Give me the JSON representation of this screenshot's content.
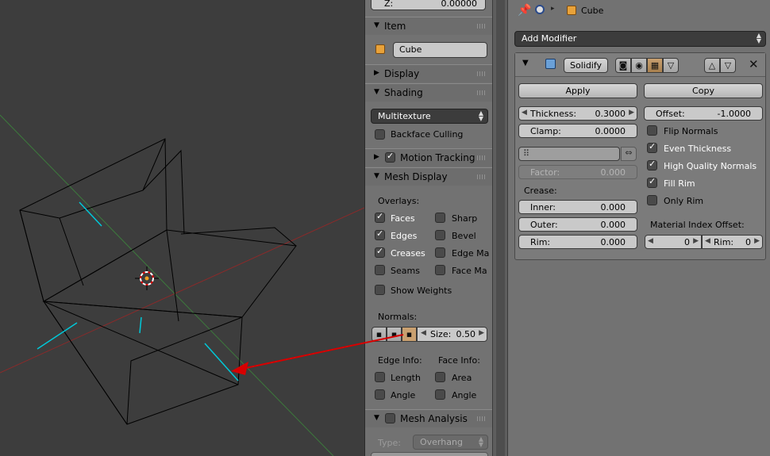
{
  "npanel": {
    "z_label": "Z:",
    "z_value": "0.00000",
    "item_header": "Item",
    "item_name": "Cube",
    "display_header": "Display",
    "shading_header": "Shading",
    "shading_mode": "Multitexture",
    "backface_culling": "Backface Culling",
    "motion_tracking_header": "Motion Tracking",
    "mesh_display_header": "Mesh Display",
    "overlays_label": "Overlays:",
    "overlay_faces": "Faces",
    "overlay_edges": "Edges",
    "overlay_creases": "Creases",
    "overlay_seams": "Seams",
    "overlay_sharp": "Sharp",
    "overlay_bevel": "Bevel",
    "overlay_edge_marks": "Edge Ma",
    "overlay_face_marks": "Face Ma",
    "show_weights": "Show Weights",
    "normals_label": "Normals:",
    "size_label": "Size:",
    "size_value": "0.50",
    "edge_info_label": "Edge Info:",
    "face_info_label": "Face Info:",
    "edge_length": "Length",
    "edge_angle": "Angle",
    "face_area": "Area",
    "face_angle": "Angle",
    "mesh_analysis_header": "Mesh Analysis",
    "type_label": "Type:",
    "type_value": "Overhang"
  },
  "props": {
    "breadcrumb_object": "Cube",
    "add_modifier": "Add Modifier",
    "modifier_name": "Solidify",
    "apply_label": "Apply",
    "copy_label": "Copy",
    "thickness_label": "Thickness:",
    "thickness_value": "0.3000",
    "offset_label": "Offset:",
    "offset_value": "-1.0000",
    "clamp_label": "Clamp:",
    "clamp_value": "0.0000",
    "flip_normals": "Flip Normals",
    "even_thickness": "Even Thickness",
    "high_quality_normals": "High Quality Normals",
    "fill_rim": "Fill Rim",
    "only_rim": "Only Rim",
    "factor_label": "Factor:",
    "factor_value": "0.000",
    "crease_label": "Crease:",
    "inner_label": "Inner:",
    "inner_value": "0.000",
    "outer_label": "Outer:",
    "outer_value": "0.000",
    "rim_label": "Rim:",
    "rim_value": "0.000",
    "material_index_offset": "Material Index Offset:",
    "mat_offset_value": "0",
    "mat_rim_label": "Rim:",
    "mat_rim_value": "0"
  },
  "checks": {
    "backface_culling": false,
    "motion_tracking": true,
    "faces": true,
    "edges": true,
    "creases": true,
    "seams": false,
    "sharp": false,
    "bevel": false,
    "edge_marks": false,
    "face_marks": false,
    "show_weights": false,
    "edge_length": false,
    "edge_angle": false,
    "face_area": false,
    "face_angle": false,
    "mesh_analysis": false,
    "flip_normals": false,
    "even_thickness": true,
    "high_quality_normals": true,
    "fill_rim": true,
    "only_rim": false
  },
  "colors": {
    "viewport_bg": "#3d3d3d",
    "panel_bg": "#727272",
    "annotation_arrow": "#d80000",
    "crease_highlight": "#00c8d8",
    "x_axis": "#8a2a2a",
    "y_axis": "#3c7a3c"
  },
  "icons": {
    "pin": "pin-icon",
    "scene": "scene-object-icon",
    "cube": "cube-object-icon",
    "modifier_cube": "modifier-mesh-icon",
    "render": "camera-render-icon",
    "view": "eye-visibility-icon",
    "editmode": "editmode-icon",
    "cage": "vertex-cage-icon",
    "move_up": "move-up-icon",
    "move_down": "move-down-icon",
    "close": "close-x-icon"
  }
}
